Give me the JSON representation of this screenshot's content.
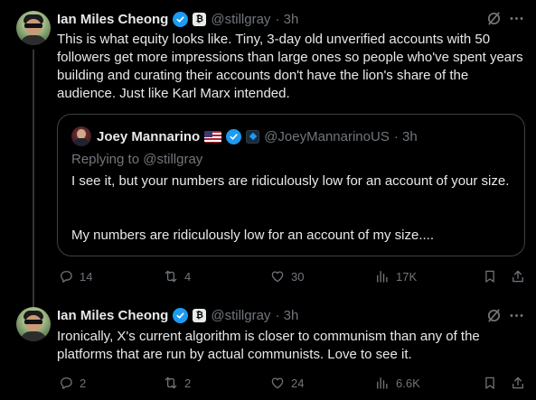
{
  "tweets": [
    {
      "author": "Ian Miles Cheong",
      "handle": "@stillgray",
      "time": "· 3h",
      "text": "This is what equity looks like. Tiny, 3-day old unverified accounts with 50 followers get more impressions than large ones so people who've spent years building and curating their accounts don't have the lion's share of the audience. Just like Karl Marx intended.",
      "stats": {
        "replies": "14",
        "retweets": "4",
        "likes": "30",
        "views": "17K"
      }
    },
    {
      "author": "Ian Miles Cheong",
      "handle": "@stillgray",
      "time": "· 3h",
      "text": "Ironically, X's current algorithm is closer to communism than any of the platforms that are run by actual communists. Love to see it.",
      "stats": {
        "replies": "2",
        "retweets": "2",
        "likes": "24",
        "views": "6.6K"
      }
    }
  ],
  "quote": {
    "author": "Joey Mannarino",
    "handle": "@JoeyMannarinoUS",
    "time": "· 3h",
    "replying_to": "Replying to @stillgray",
    "line1": "I see it, but your numbers are ridiculously low for an account of your size.",
    "line2": "My numbers are ridiculously low for an account of my size...."
  },
  "colors": {
    "background": "#000000",
    "text": "#e7e9ea",
    "secondary": "#71767b",
    "verified": "#1d9bf0",
    "border": "#3e4144"
  }
}
